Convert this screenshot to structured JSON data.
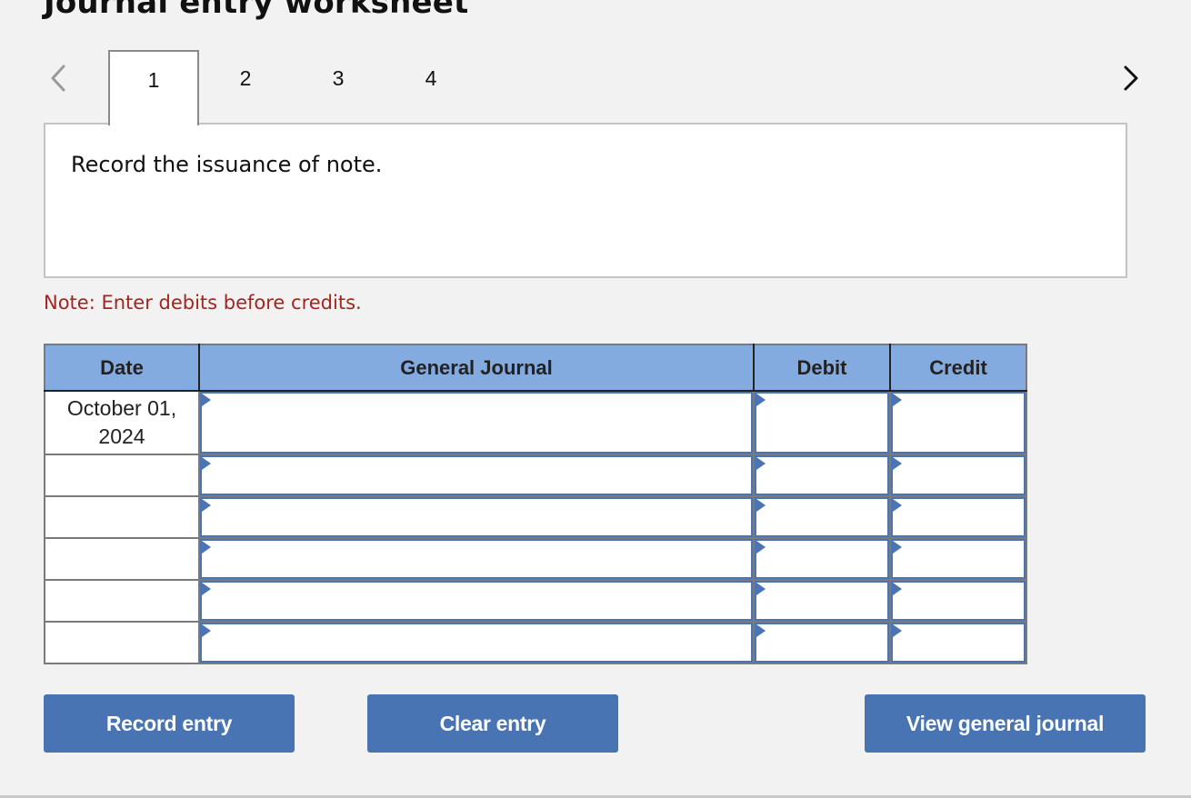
{
  "title": "Journal entry worksheet",
  "navigation": {
    "prev_icon": "chevron-left-icon",
    "next_icon": "chevron-right-icon",
    "tabs": [
      {
        "label": "1",
        "active": true
      },
      {
        "label": "2",
        "active": false
      },
      {
        "label": "3",
        "active": false
      },
      {
        "label": "4",
        "active": false
      }
    ]
  },
  "prompt": "Record the issuance of note.",
  "note": "Note: Enter debits before credits.",
  "colors": {
    "header_bg": "#84abe0",
    "button_bg": "#4874b4",
    "note_text": "#a6231f",
    "field_border": "#4a74b4"
  },
  "journal": {
    "headers": [
      "Date",
      "General Journal",
      "Debit",
      "Credit"
    ],
    "rows": [
      {
        "date": "October 01, 2024",
        "account": "",
        "debit": "",
        "credit": ""
      },
      {
        "date": "",
        "account": "",
        "debit": "",
        "credit": ""
      },
      {
        "date": "",
        "account": "",
        "debit": "",
        "credit": ""
      },
      {
        "date": "",
        "account": "",
        "debit": "",
        "credit": ""
      },
      {
        "date": "",
        "account": "",
        "debit": "",
        "credit": ""
      },
      {
        "date": "",
        "account": "",
        "debit": "",
        "credit": ""
      }
    ]
  },
  "buttons": {
    "record": "Record entry",
    "clear": "Clear entry",
    "view": "View general journal"
  }
}
